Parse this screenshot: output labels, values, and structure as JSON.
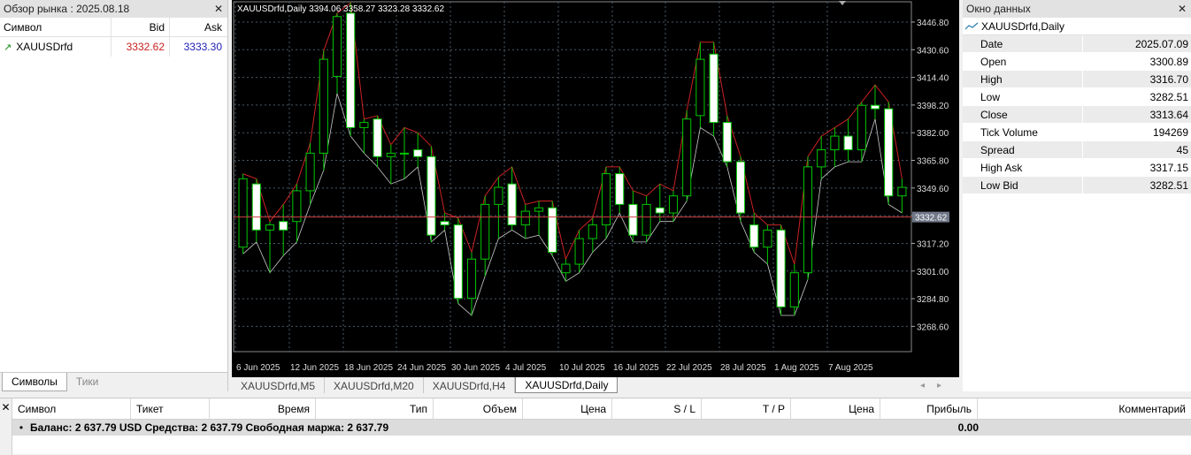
{
  "market_watch": {
    "title": "Обзор рынка : 2025.08.18",
    "close": "✕",
    "columns": {
      "symbol": "Символ",
      "bid": "Bid",
      "ask": "Ask"
    },
    "rows": [
      {
        "symbol": "XAUUSDrfd",
        "bid": "3332.62",
        "ask": "3333.30"
      }
    ],
    "tabs": [
      "Символы",
      "Тики"
    ]
  },
  "chart": {
    "header": "XAUUSDrfd,Daily  3394.06 3358.27 3323.28 3332.62",
    "current_price": 3332.62,
    "current_price_label": "3332.62",
    "price_range": [
      3253.8,
      3456.6
    ],
    "price_ticks": [
      "3446.80",
      "3430.60",
      "3414.40",
      "3398.20",
      "3382.00",
      "3365.80",
      "3349.60",
      "3333.40",
      "3317.20",
      "3301.00",
      "3284.80",
      "3268.60"
    ],
    "date_labels": [
      "6 Jun 2025",
      "12 Jun 2025",
      "18 Jun 2025",
      "24 Jun 2025",
      "30 Jun 2025",
      "4 Jul 2025",
      "10 Jul 2025",
      "16 Jul 2025",
      "22 Jul 2025",
      "28 Jul 2025",
      "1 Aug 2025",
      "7 Aug 2025"
    ],
    "colors": {
      "bull": "#00c800",
      "bear_fill": "#ffffff",
      "grid": "#4a5a6a",
      "upper_band": "#cc2222",
      "lower_band": "#cccccc",
      "price_line": "#d04040",
      "axis_label_bg": "#707888"
    }
  },
  "chart_data": {
    "type": "candlestick",
    "symbol": "XAUUSDrfd",
    "timeframe": "Daily",
    "ohlc_last": {
      "open": 3394.06,
      "high": 3358.27,
      "low": 3323.28,
      "close": 3332.62
    },
    "candles": [
      [
        3315,
        3358,
        3311,
        3355
      ],
      [
        3352,
        3355,
        3318,
        3325
      ],
      [
        3325,
        3330,
        3300,
        3328
      ],
      [
        3330,
        3340,
        3310,
        3325
      ],
      [
        3330,
        3352,
        3318,
        3348
      ],
      [
        3348,
        3376,
        3340,
        3370
      ],
      [
        3370,
        3430,
        3360,
        3425
      ],
      [
        3415,
        3452,
        3405,
        3450
      ],
      [
        3452,
        3458,
        3380,
        3385
      ],
      [
        3385,
        3390,
        3370,
        3388
      ],
      [
        3390,
        3392,
        3362,
        3368
      ],
      [
        3368,
        3375,
        3352,
        3370
      ],
      [
        3370,
        3385,
        3355,
        3370
      ],
      [
        3372,
        3382,
        3362,
        3368
      ],
      [
        3368,
        3374,
        3318,
        3322
      ],
      [
        3330,
        3335,
        3325,
        3328
      ],
      [
        3328,
        3332,
        3282,
        3285
      ],
      [
        3285,
        3312,
        3275,
        3308
      ],
      [
        3308,
        3345,
        3298,
        3340
      ],
      [
        3340,
        3356,
        3320,
        3350
      ],
      [
        3352,
        3362,
        3325,
        3328
      ],
      [
        3328,
        3340,
        3320,
        3336
      ],
      [
        3336,
        3342,
        3322,
        3338
      ],
      [
        3338,
        3342,
        3310,
        3312
      ],
      [
        3300,
        3308,
        3295,
        3305
      ],
      [
        3305,
        3325,
        3300,
        3320
      ],
      [
        3320,
        3332,
        3312,
        3328
      ],
      [
        3328,
        3362,
        3320,
        3358
      ],
      [
        3358,
        3362,
        3335,
        3340
      ],
      [
        3340,
        3348,
        3318,
        3322
      ],
      [
        3322,
        3345,
        3318,
        3340
      ],
      [
        3338,
        3352,
        3330,
        3335
      ],
      [
        3335,
        3348,
        3330,
        3345
      ],
      [
        3345,
        3395,
        3342,
        3390
      ],
      [
        3392,
        3435,
        3385,
        3425
      ],
      [
        3428,
        3435,
        3380,
        3388
      ],
      [
        3388,
        3392,
        3362,
        3365
      ],
      [
        3365,
        3368,
        3330,
        3335
      ],
      [
        3328,
        3335,
        3312,
        3315
      ],
      [
        3315,
        3328,
        3305,
        3325
      ],
      [
        3325,
        3328,
        3275,
        3280
      ],
      [
        3280,
        3305,
        3275,
        3300
      ],
      [
        3300,
        3368,
        3296,
        3362
      ],
      [
        3362,
        3380,
        3355,
        3372
      ],
      [
        3372,
        3385,
        3362,
        3380
      ],
      [
        3380,
        3390,
        3365,
        3372
      ],
      [
        3372,
        3400,
        3365,
        3398
      ],
      [
        3398,
        3410,
        3390,
        3396
      ],
      [
        3396,
        3400,
        3340,
        3345
      ],
      [
        3345,
        3355,
        3335,
        3350
      ]
    ],
    "price_min": 3253.8,
    "price_max": 3456.6
  },
  "chart_tabs": [
    "XAUUSDrfd,M5",
    "XAUUSDrfd,M20",
    "XAUUSDrfd,H4",
    "XAUUSDrfd,Daily"
  ],
  "chart_tabs_active": 3,
  "chart_nav": {
    "left": "◂",
    "right": "▸"
  },
  "data_window": {
    "title": "Окно данных",
    "close": "✕",
    "series": "XAUUSDrfd,Daily",
    "rows": [
      {
        "k": "Date",
        "v": "2025.07.09"
      },
      {
        "k": "Open",
        "v": "3300.89"
      },
      {
        "k": "High",
        "v": "3316.70"
      },
      {
        "k": "Low",
        "v": "3282.51"
      },
      {
        "k": "Close",
        "v": "3313.64"
      },
      {
        "k": "Tick Volume",
        "v": "194269"
      },
      {
        "k": "Spread",
        "v": "45"
      },
      {
        "k": "High Ask",
        "v": "3317.15"
      },
      {
        "k": "Low Bid",
        "v": "3282.51"
      }
    ]
  },
  "terminal": {
    "close": "✕",
    "columns": [
      "Символ",
      "Тикет",
      "Время",
      "Тип",
      "Объем",
      "Цена",
      "S / L",
      "T / P",
      "Цена",
      "Прибыль",
      "Комментарий"
    ],
    "balance_line": "Баланс: 2 637.79 USD  Средства: 2 637.79  Свободная маржа: 2 637.79",
    "profit": "0.00"
  }
}
